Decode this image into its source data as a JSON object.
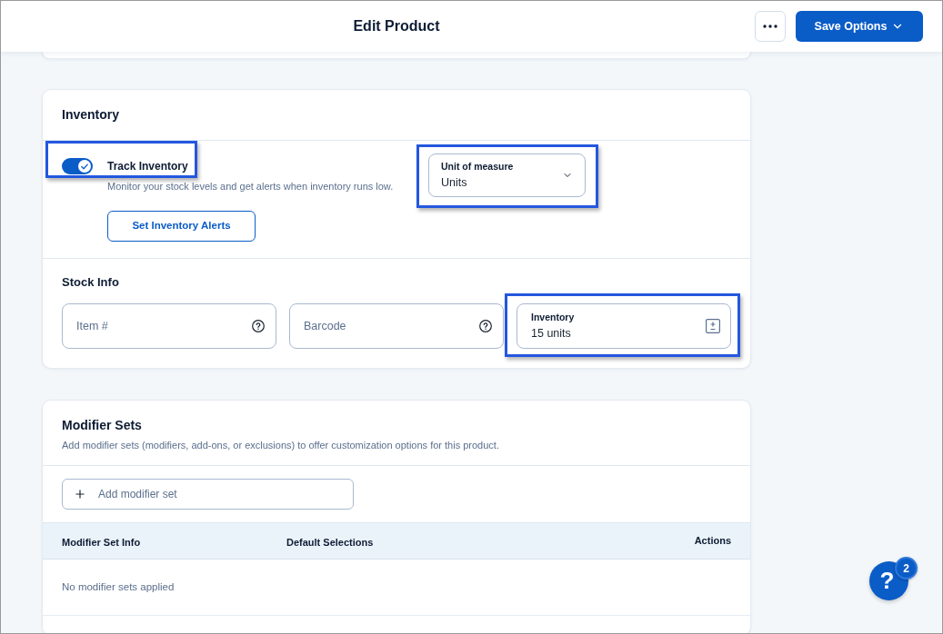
{
  "header": {
    "title": "Edit Product",
    "save_button": "Save Options"
  },
  "inventory": {
    "title": "Inventory",
    "track_inventory": {
      "label": "Track Inventory",
      "description": "Monitor your stock levels and get alerts when inventory runs low.",
      "on": true,
      "highlighted": true
    },
    "alerts_button": "Set Inventory Alerts",
    "unit_of_measure": {
      "label": "Unit of measure",
      "value": "Units",
      "highlighted": true
    },
    "stock_info": {
      "title": "Stock Info",
      "fields": [
        {
          "kind": "help",
          "placeholder": "Item #",
          "highlighted": false
        },
        {
          "kind": "help",
          "placeholder": "Barcode",
          "highlighted": false
        },
        {
          "kind": "adjust",
          "label": "Inventory",
          "value": "15 units",
          "highlighted": true
        }
      ]
    }
  },
  "modifier_sets": {
    "title": "Modifier Sets",
    "description": "Add modifier sets (modifiers, add-ons, or exclusions) to offer customization options for this product.",
    "add_button": "Add modifier set",
    "table": {
      "columns": [
        "Modifier Set Info",
        "Default Selections",
        "Actions"
      ],
      "empty_message": "No modifier sets applied"
    }
  },
  "help": {
    "label": "?",
    "badge": "2"
  }
}
